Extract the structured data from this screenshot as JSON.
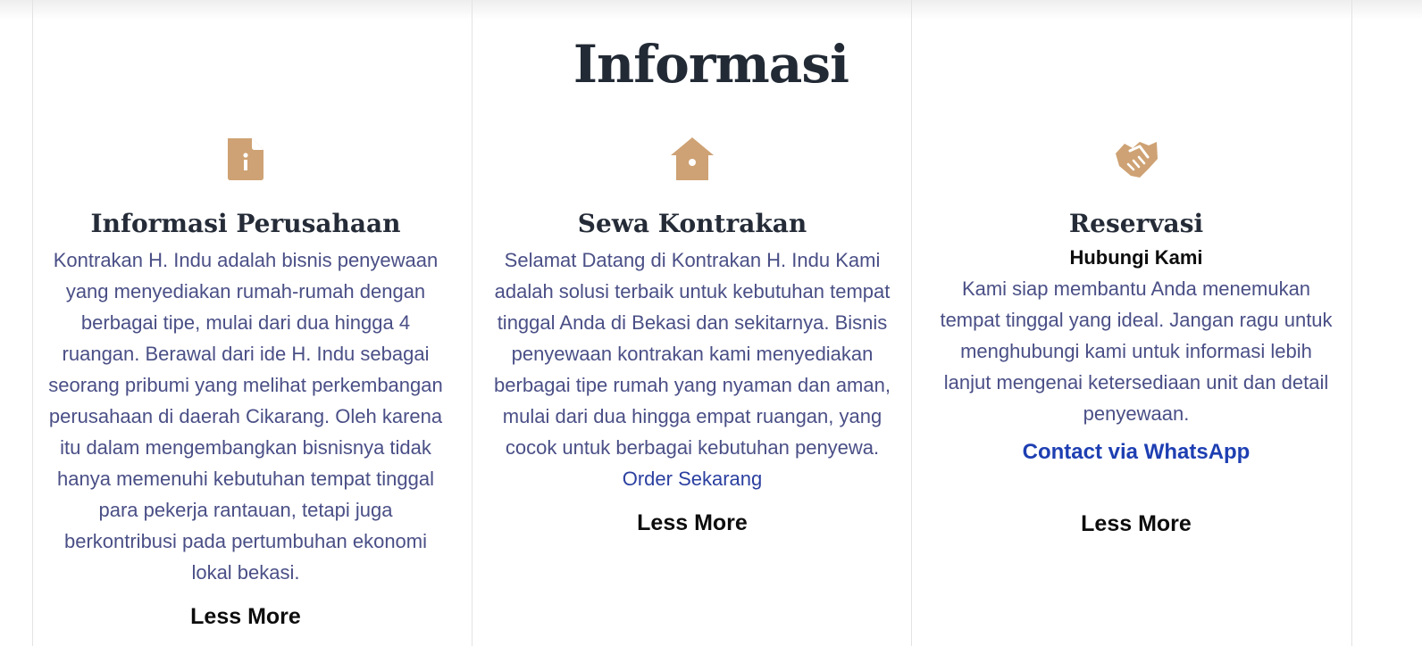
{
  "section": {
    "title": "Informasi"
  },
  "columns": [
    {
      "icon": "file-info-icon",
      "title": "Informasi Perusahaan",
      "body": "Kontrakan H. Indu adalah bisnis penyewaan yang menyediakan rumah-rumah dengan berbagai tipe, mulai dari dua hingga 4 ruangan. Berawal dari ide H. Indu sebagai seorang pribumi yang melihat perkembangan perusahaan di daerah Cikarang. Oleh karena itu dalam mengembangkan bisnisnya tidak hanya memenuhi kebutuhan tempat tinggal para pekerja rantauan, tetapi juga berkontribusi pada pertumbuhan ekonomi lokal bekasi.",
      "less_more": "Less More"
    },
    {
      "icon": "house-icon",
      "title": "Sewa Kontrakan",
      "body": "Selamat Datang di Kontrakan H. Indu Kami adalah solusi terbaik untuk kebutuhan tempat tinggal Anda di Bekasi dan sekitarnya. Bisnis penyewaan kontrakan kami menyediakan berbagai tipe rumah yang nyaman dan aman, mulai dari dua hingga empat ruangan, yang cocok untuk berbagai kebutuhan penyewa.",
      "link": "Order Sekarang",
      "less_more": "Less More"
    },
    {
      "icon": "handshake-icon",
      "title": "Reservasi",
      "subtitle": "Hubungi Kami",
      "body": "Kami siap membantu Anda menemukan tempat tinggal yang ideal. Jangan ragu untuk menghubungi kami untuk informasi lebih lanjut mengenai ketersediaan unit dan detail penyewaan.",
      "link": "Contact via WhatsApp",
      "less_more": "Less More"
    }
  ],
  "colors": {
    "accent": "#cea274",
    "heading": "#222a35",
    "body_text": "#4a4f86",
    "link": "#1e3fb2"
  }
}
